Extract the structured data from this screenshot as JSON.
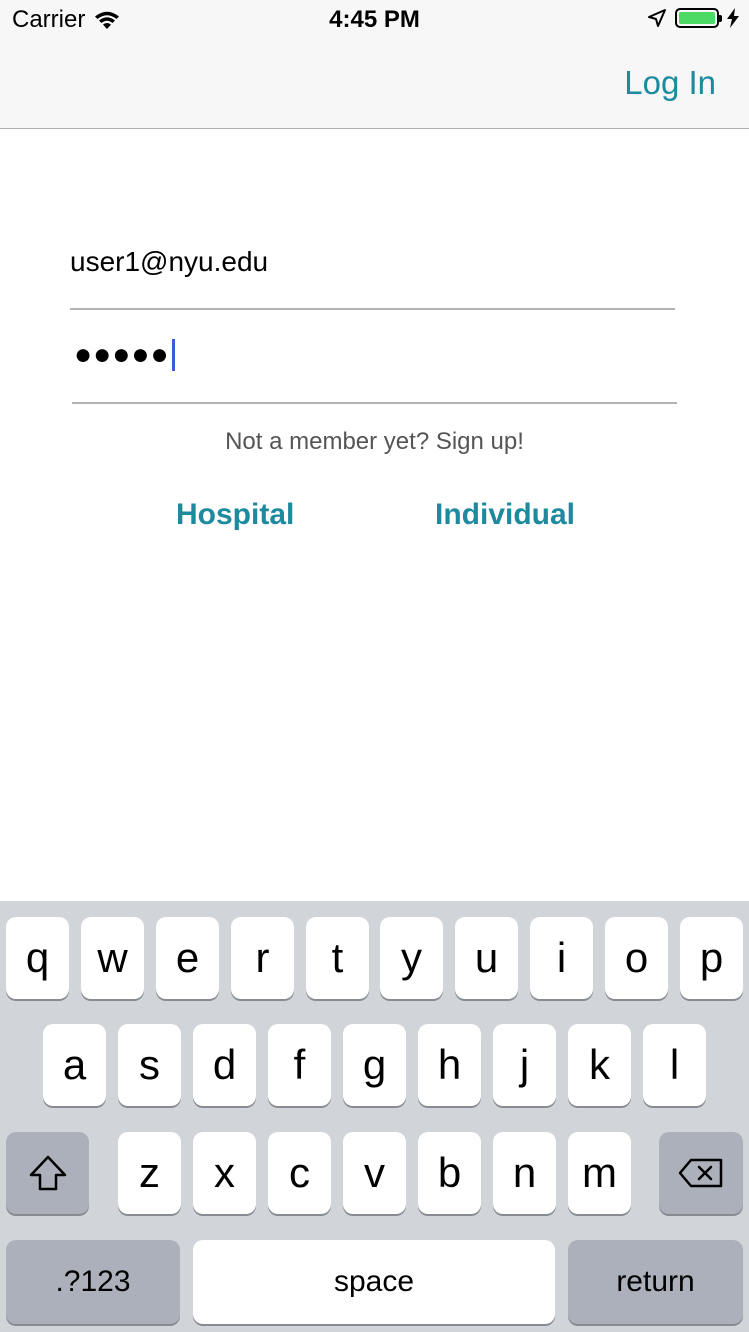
{
  "status_bar": {
    "carrier": "Carrier",
    "time": "4:45 PM",
    "battery_level": 1.0,
    "battery_color": "#4cd964"
  },
  "nav": {
    "login_label": "Log In",
    "accent_color": "#1d8a9e"
  },
  "form": {
    "email_value": "user1@nyu.edu",
    "password_mask": "●●●●●",
    "signup_prompt": "Not a member yet? Sign up!",
    "hospital_label": "Hospital",
    "individual_label": "Individual"
  },
  "keyboard": {
    "row1": [
      "q",
      "w",
      "e",
      "r",
      "t",
      "y",
      "u",
      "i",
      "o",
      "p"
    ],
    "row2": [
      "a",
      "s",
      "d",
      "f",
      "g",
      "h",
      "j",
      "k",
      "l"
    ],
    "row3": [
      "z",
      "x",
      "c",
      "v",
      "b",
      "n",
      "m"
    ],
    "numbers_label": ".?123",
    "space_label": "space",
    "return_label": "return",
    "shift_icon": "shift-icon",
    "delete_icon": "delete-icon"
  }
}
